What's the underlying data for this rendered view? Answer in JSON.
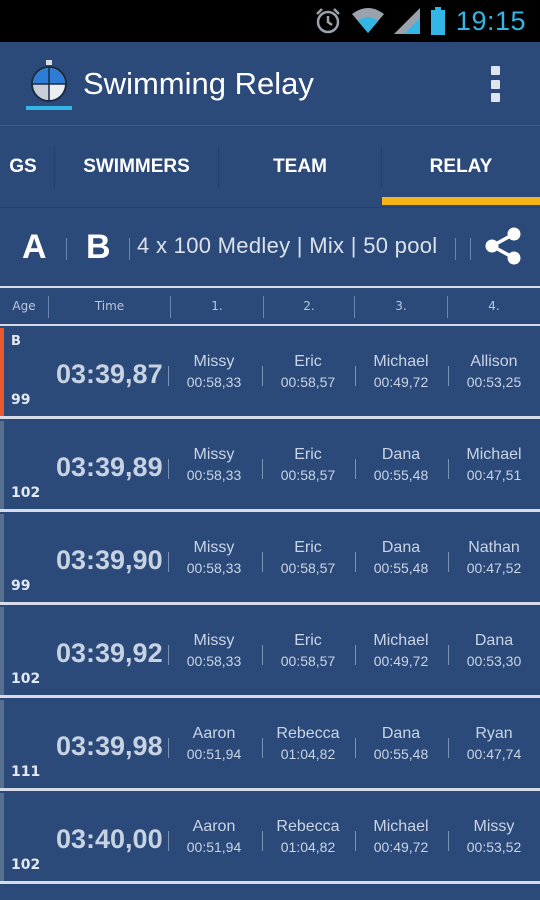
{
  "status_bar": {
    "time": "19:15",
    "icons": [
      "alarm-icon",
      "wifi-icon",
      "signal-icon",
      "battery-icon"
    ]
  },
  "action_bar": {
    "title": "Swimming Relay",
    "logo": "stopwatch-logo-icon",
    "overflow": "overflow-menu-icon"
  },
  "tabs": [
    {
      "label": "GS",
      "selected": false
    },
    {
      "label": "SWIMMERS",
      "selected": false
    },
    {
      "label": "TEAM",
      "selected": false
    },
    {
      "label": "RELAY",
      "selected": true
    }
  ],
  "relay_header": {
    "team_a": "A",
    "team_b": "B",
    "description": "4 x 100 Medley | Mix | 50 pool",
    "share_icon": "share-icon"
  },
  "columns": [
    "Age",
    "Time",
    "1.",
    "2.",
    "3.",
    "4."
  ],
  "rows": [
    {
      "tag": "B",
      "age": "99",
      "time": "03:39,87",
      "legs": [
        {
          "name": "Missy",
          "time": "00:58,33"
        },
        {
          "name": "Eric",
          "time": "00:58,57"
        },
        {
          "name": "Michael",
          "time": "00:49,72"
        },
        {
          "name": "Allison",
          "time": "00:53,25"
        }
      ]
    },
    {
      "tag": "",
      "age": "102",
      "time": "03:39,89",
      "legs": [
        {
          "name": "Missy",
          "time": "00:58,33"
        },
        {
          "name": "Eric",
          "time": "00:58,57"
        },
        {
          "name": "Dana",
          "time": "00:55,48"
        },
        {
          "name": "Michael",
          "time": "00:47,51"
        }
      ]
    },
    {
      "tag": "",
      "age": "99",
      "time": "03:39,90",
      "legs": [
        {
          "name": "Missy",
          "time": "00:58,33"
        },
        {
          "name": "Eric",
          "time": "00:58,57"
        },
        {
          "name": "Dana",
          "time": "00:55,48"
        },
        {
          "name": "Nathan",
          "time": "00:47,52"
        }
      ]
    },
    {
      "tag": "",
      "age": "102",
      "time": "03:39,92",
      "legs": [
        {
          "name": "Missy",
          "time": "00:58,33"
        },
        {
          "name": "Eric",
          "time": "00:58,57"
        },
        {
          "name": "Michael",
          "time": "00:49,72"
        },
        {
          "name": "Dana",
          "time": "00:53,30"
        }
      ]
    },
    {
      "tag": "",
      "age": "111",
      "time": "03:39,98",
      "legs": [
        {
          "name": "Aaron",
          "time": "00:51,94"
        },
        {
          "name": "Rebecca",
          "time": "01:04,82"
        },
        {
          "name": "Dana",
          "time": "00:55,48"
        },
        {
          "name": "Ryan",
          "time": "00:47,74"
        }
      ]
    },
    {
      "tag": "",
      "age": "102",
      "time": "03:40,00",
      "legs": [
        {
          "name": "Aaron",
          "time": "00:51,94"
        },
        {
          "name": "Rebecca",
          "time": "01:04,82"
        },
        {
          "name": "Michael",
          "time": "00:49,72"
        },
        {
          "name": "Missy",
          "time": "00:53,52"
        }
      ]
    }
  ],
  "colors": {
    "background": "#2b4a7a",
    "accent_tab": "#f5b418",
    "accent_status": "#33b5e5",
    "active_row_edge": "#e8582c"
  }
}
